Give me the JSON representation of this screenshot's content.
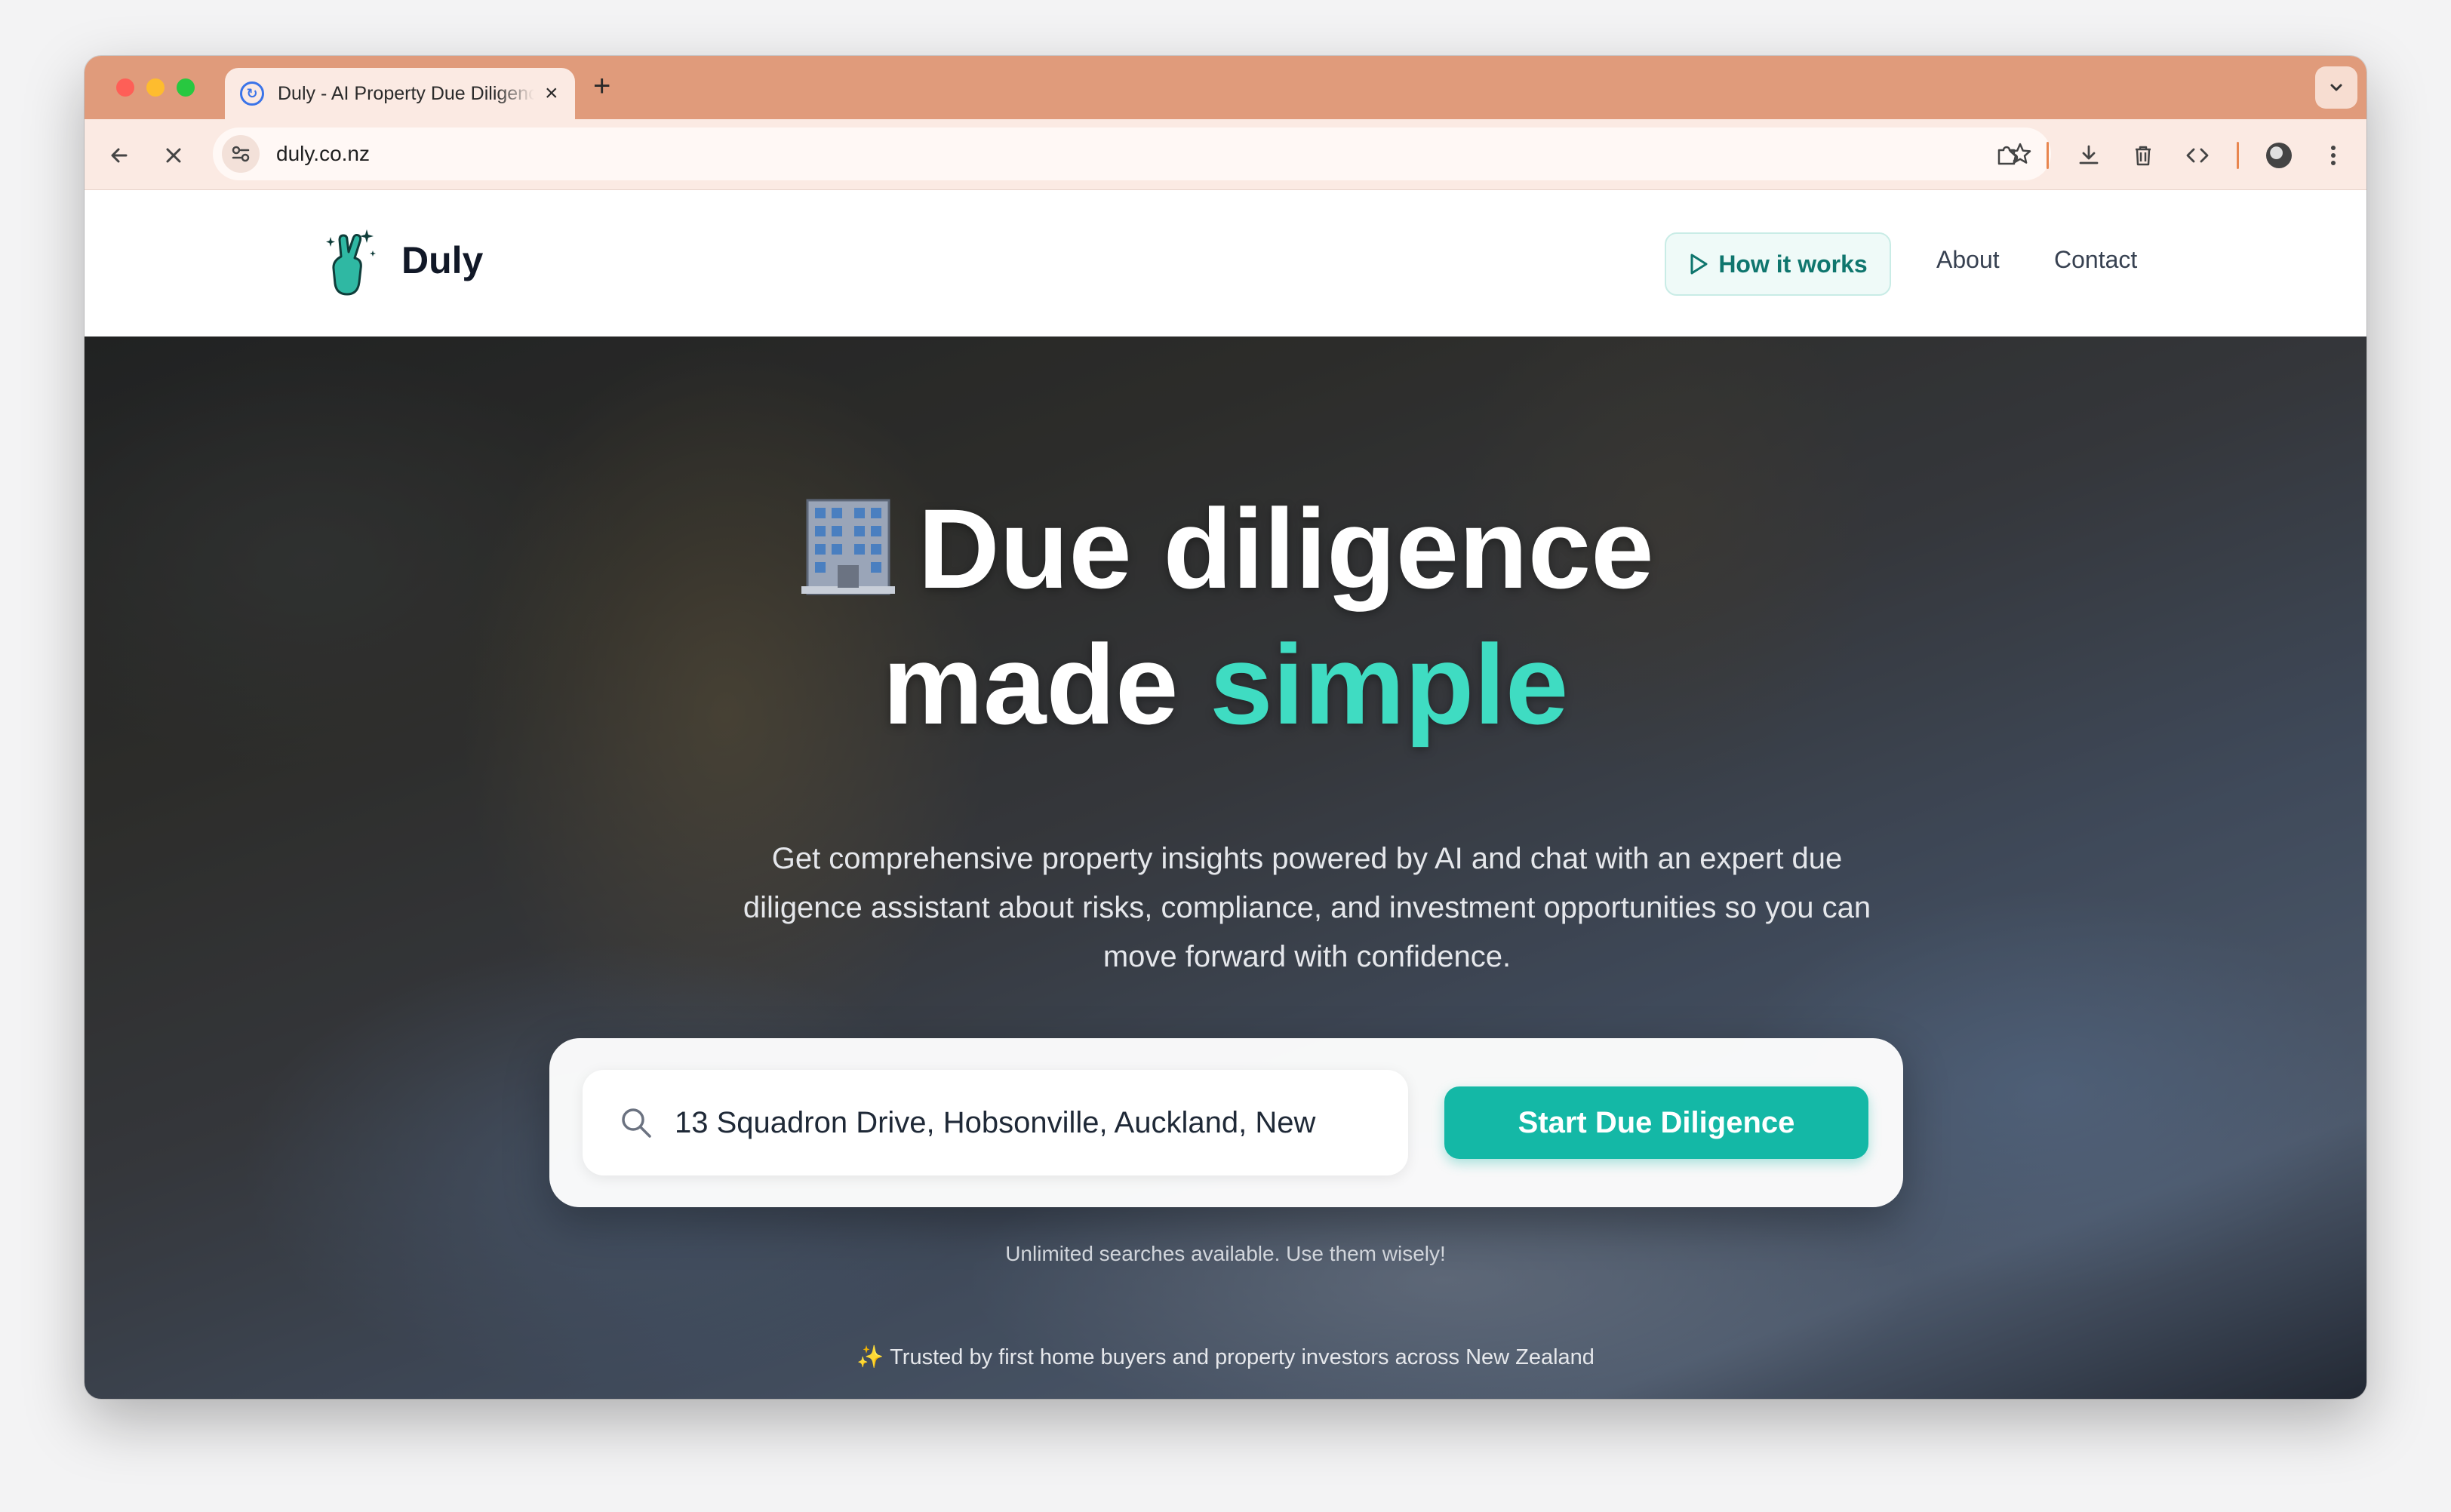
{
  "browser": {
    "tab_title": "Duly - AI Property Due Diligence",
    "tab_close": "×",
    "new_tab": "+",
    "url": "duly.co.nz",
    "theme_color": "#e09b7b"
  },
  "header": {
    "logo_text": "Duly",
    "nav": {
      "how_it_works": "How it works",
      "about": "About",
      "contact": "Contact"
    }
  },
  "hero": {
    "title_emoji": "🏢",
    "title_line1": "Due diligence",
    "title_line2_plain": "made ",
    "title_line2_accent": "simple",
    "accent_color": "#3fdcc2",
    "subtitle": "Get comprehensive property insights powered by AI and chat with an expert due diligence assistant about risks, compliance, and investment opportunities so you can move forward with confidence.",
    "search_value": "13 Squadron Drive, Hobsonville, Auckland, New",
    "cta_label": "Start Due Diligence",
    "cta_color": "#14b8a6",
    "unlimited_note": "Unlimited searches available. Use them wisely!",
    "trusted_sparkle": "✨",
    "trusted_text": "Trusted by first home buyers and property investors across New Zealand"
  }
}
